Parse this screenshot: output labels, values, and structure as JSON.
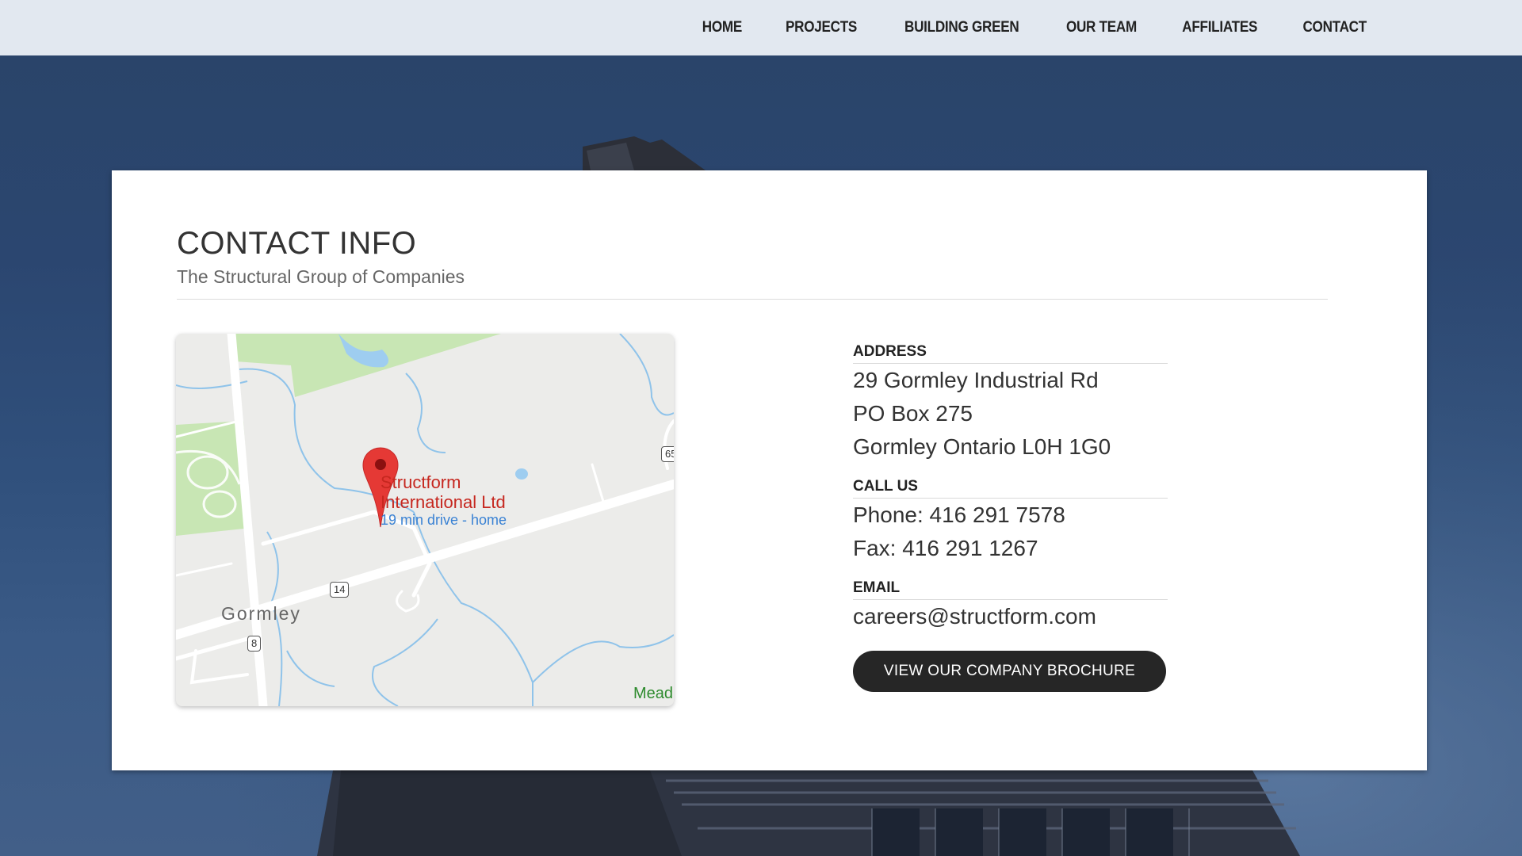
{
  "nav": {
    "items": [
      {
        "label": "HOME"
      },
      {
        "label": "PROJECTS"
      },
      {
        "label": "BUILDING GREEN"
      },
      {
        "label": "OUR TEAM"
      },
      {
        "label": "AFFILIATES"
      },
      {
        "label": "CONTACT"
      }
    ]
  },
  "page": {
    "title": "CONTACT INFO",
    "subtitle": "The Structural Group of Companies"
  },
  "map": {
    "place_name_line1": "Structform",
    "place_name_line2": "International Ltd",
    "drive_time": "19 min drive - home",
    "town": "Gormley",
    "route_shields": [
      "14",
      "8",
      "65"
    ],
    "edge_label": "Mead",
    "marker_icon": "map-pin-icon",
    "marker_color": "#e53935"
  },
  "address": {
    "heading": "ADDRESS",
    "lines": [
      "29 Gormley Industrial Rd",
      "PO Box 275",
      "Gormley Ontario L0H 1G0"
    ]
  },
  "call": {
    "heading": "CALL US",
    "phone": "Phone: 416 291 7578",
    "fax": "Fax: 416 291 1267"
  },
  "email": {
    "heading": "EMAIL",
    "address": "careers@structform.com"
  },
  "cta": {
    "brochure_label": "VIEW OUR COMPANY BROCHURE"
  },
  "colors": {
    "nav_background": "#e2e8f0",
    "button_background": "#262626",
    "marker": "#e53935",
    "drive_text": "#3a82d4"
  }
}
